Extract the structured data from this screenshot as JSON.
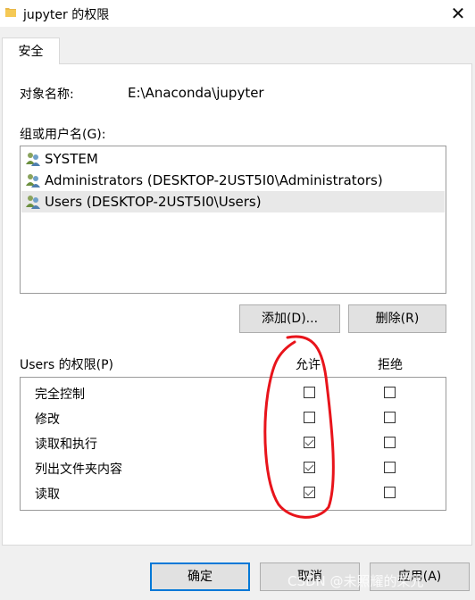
{
  "window": {
    "title": "jupyter 的权限",
    "close_glyph": "✕"
  },
  "tabs": [
    {
      "label": "安全",
      "active": true
    }
  ],
  "object": {
    "label": "对象名称:",
    "value": "E:\\Anaconda\\jupyter"
  },
  "groups": {
    "label": "组或用户名(G):",
    "items": [
      {
        "name": "SYSTEM",
        "icon": "users-icon",
        "selected": false
      },
      {
        "name": "Administrators (DESKTOP-2UST5I0\\Administrators)",
        "icon": "users-icon",
        "selected": false
      },
      {
        "name": "Users (DESKTOP-2UST5I0\\Users)",
        "icon": "users-icon",
        "selected": true
      }
    ]
  },
  "buttons": {
    "add": "添加(D)...",
    "remove": "删除(R)",
    "ok": "确定",
    "cancel": "取消",
    "apply": "应用(A)"
  },
  "permissions": {
    "title": "Users 的权限(P)",
    "allow_header": "允许",
    "deny_header": "拒绝",
    "rows": [
      {
        "name": "完全控制",
        "allow": false,
        "deny": false
      },
      {
        "name": "修改",
        "allow": false,
        "deny": false
      },
      {
        "name": "读取和执行",
        "allow": true,
        "deny": false
      },
      {
        "name": "列出文件夹内容",
        "allow": true,
        "deny": false
      },
      {
        "name": "读取",
        "allow": true,
        "deny": false
      }
    ]
  },
  "watermark": "CSDN @未照耀的荣光",
  "colors": {
    "annotation_red": "#e8141b",
    "focus_blue": "#0078d7",
    "selection_gray": "#e8e8e8"
  }
}
